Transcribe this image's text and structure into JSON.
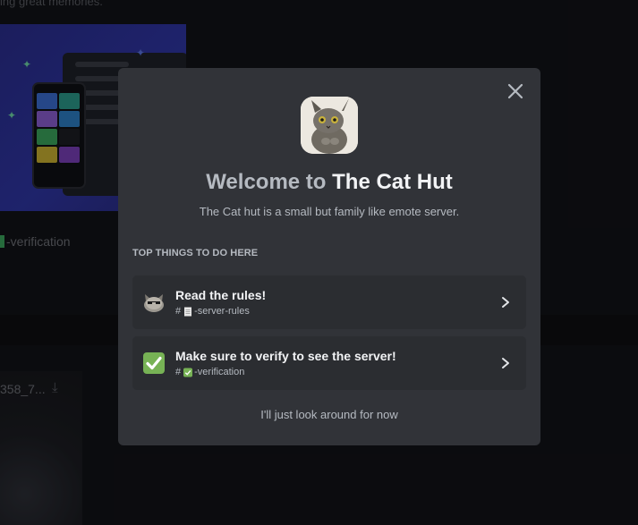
{
  "background": {
    "top_text": "ing great memories.",
    "channel_label": "-verification",
    "file_name": "358_7..."
  },
  "modal": {
    "title_prefix": "Welcome to ",
    "server_name": "The Cat Hut",
    "description": "The Cat hut is a small but family like emote server.",
    "section_heading": "TOP THINGS TO DO HERE",
    "items": [
      {
        "label": "Read the rules!",
        "hash": "#",
        "channel": "-server-rules",
        "icon": "cat-emoji-icon"
      },
      {
        "label": "Make sure to verify to see the server!",
        "hash": "#",
        "channel": "-verification",
        "icon": "check-mark-icon"
      }
    ],
    "skip_label": "I'll just look around for now"
  },
  "colors": {
    "modal_bg": "#313338",
    "item_bg": "#2b2d31",
    "check_green": "#3ba55c"
  }
}
